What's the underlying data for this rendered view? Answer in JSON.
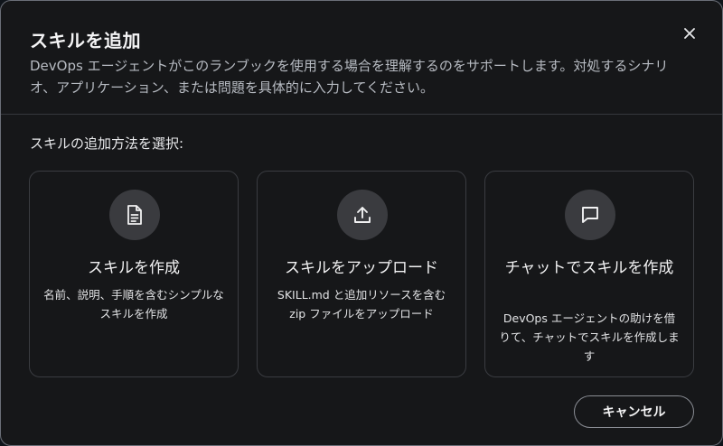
{
  "dialog": {
    "title": "スキルを追加",
    "description": "DevOps エージェントがこのランブックを使用する場合を理解するのをサポートします。対処するシナリオ、アプリケーション、または問題を具体的に入力してください。",
    "close_icon": "close-icon"
  },
  "section": {
    "label": "スキルの追加方法を選択:"
  },
  "options": [
    {
      "icon": "document-icon",
      "title": "スキルを作成",
      "description": "名前、説明、手順を含むシンプルなスキルを作成"
    },
    {
      "icon": "upload-icon",
      "title": "スキルをアップロード",
      "description": "SKILL.md と追加リソースを含む zip ファイルをアップロード"
    },
    {
      "icon": "chat-icon",
      "title": "チャットでスキルを作成",
      "description": "DevOps エージェントの助けを借りて、チャットでスキルを作成します"
    }
  ],
  "footer": {
    "cancel_label": "キャンセル"
  },
  "colors": {
    "background": "#161719",
    "border": "#3a3c41",
    "icon_circle": "#3a3b3f",
    "text": "#f2f2f3",
    "muted_text": "#b7bbc2"
  }
}
